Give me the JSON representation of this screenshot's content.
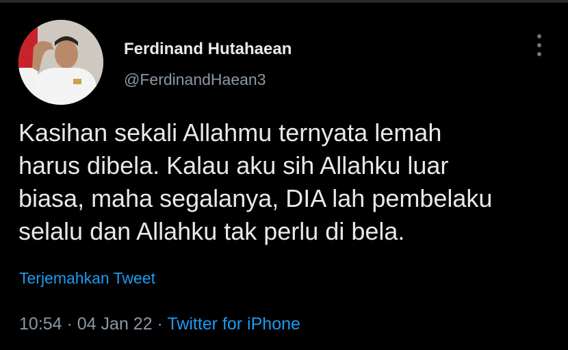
{
  "tweet": {
    "display_name": "Ferdinand Hutahaean",
    "handle": "@FerdinandHaean3",
    "text_lines": [
      "Kasihan sekali Allahmu ternyata lemah",
      "harus dibela. Kalau aku sih Allahku luar",
      "biasa, maha segalanya, DIA lah pembelaku",
      "selalu dan Allahku tak perlu di bela."
    ],
    "translate_label": "Terjemahkan Tweet",
    "time": "10:54",
    "separator": " · ",
    "date": "04 Jan 22",
    "source": "Twitter for iPhone"
  },
  "icons": {
    "more": "more-vertical-icon",
    "avatar": "profile-photo"
  },
  "colors": {
    "background": "#000000",
    "primary_text": "#e7e9ea",
    "secondary_text": "#8b98a5",
    "link": "#1d9bf0"
  }
}
